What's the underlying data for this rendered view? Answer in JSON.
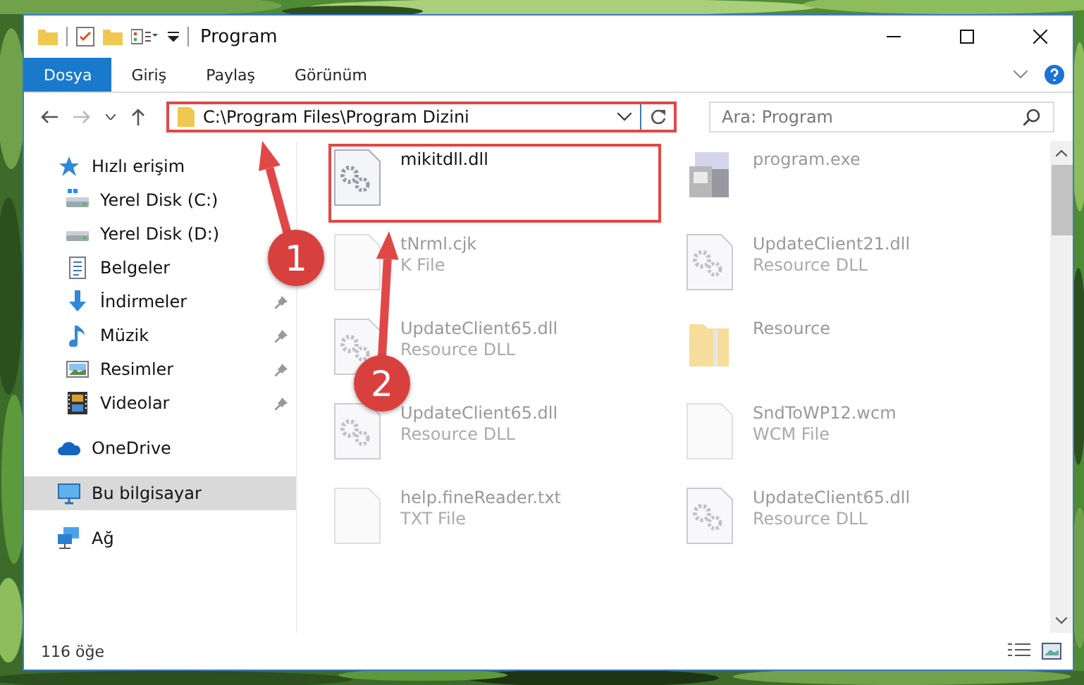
{
  "window": {
    "title": "Program"
  },
  "ribbon_tabs": [
    {
      "label": "Dosya",
      "selected": true
    },
    {
      "label": "Giriş",
      "selected": false
    },
    {
      "label": "Paylaş",
      "selected": false
    },
    {
      "label": "Görünüm",
      "selected": false
    }
  ],
  "address": {
    "value": "C:\\Program Files\\Program Dizini",
    "highlighted": true
  },
  "search": {
    "placeholder": "Ara: Program"
  },
  "sidebar": {
    "items": [
      {
        "label": "Hızlı erişim",
        "kind": "star",
        "selected": false,
        "children": [
          {
            "label": "Yerel Disk (C:)",
            "kind": "drivewin",
            "pinned": false,
            "selected": false
          },
          {
            "label": "Yerel Disk (D:)",
            "kind": "drive",
            "pinned": false,
            "selected": false
          },
          {
            "label": "Belgeler",
            "kind": "document",
            "pinned": false,
            "selected": false
          },
          {
            "label": "İndirmeler",
            "kind": "download",
            "pinned": true,
            "selected": false
          },
          {
            "label": "Müzik",
            "kind": "music",
            "pinned": true,
            "selected": false
          },
          {
            "label": "Resimler",
            "kind": "pictures",
            "pinned": true,
            "selected": false
          },
          {
            "label": "Videolar",
            "kind": "video",
            "pinned": true,
            "selected": false
          }
        ]
      },
      {
        "label": "OneDrive",
        "kind": "cloud",
        "selected": false
      },
      {
        "label": "Bu bilgisayar",
        "kind": "computer",
        "selected": true
      },
      {
        "label": "Ağ",
        "kind": "network",
        "selected": false
      }
    ]
  },
  "files": [
    {
      "name": "mikitdll.dll",
      "kind": "dll",
      "faded": false,
      "highlighted": true
    },
    {
      "name": "program.exe",
      "kind": "exe",
      "faded": true,
      "highlighted": false
    },
    {
      "name": "tNrml.cjk",
      "type": "K File",
      "kind": "file",
      "faded": true,
      "highlighted": false
    },
    {
      "name": "UpdateClient21.dll",
      "type": "Resource DLL",
      "kind": "dll",
      "faded": true,
      "highlighted": false
    },
    {
      "name": "UpdateClient65.dll",
      "type": "Resource DLL",
      "kind": "dll",
      "faded": true,
      "highlighted": false
    },
    {
      "name": "Resource",
      "kind": "folder",
      "faded": true,
      "highlighted": false
    },
    {
      "name": "UpdateClient65.dll",
      "type": "Resource DLL",
      "kind": "dll",
      "faded": true,
      "highlighted": false
    },
    {
      "name": "SndToWP12.wcm",
      "type": "WCM File",
      "kind": "file",
      "faded": true,
      "highlighted": false
    },
    {
      "name": "help.fineReader.txt",
      "type": "TXT File",
      "kind": "file",
      "faded": true,
      "highlighted": false
    },
    {
      "name": "UpdateClient65.dll",
      "type": "Resource DLL",
      "kind": "dll",
      "faded": true,
      "highlighted": false
    }
  ],
  "annotations": [
    {
      "label": "1"
    },
    {
      "label": "2"
    }
  ],
  "status_bar": {
    "count": "116 öğe"
  }
}
